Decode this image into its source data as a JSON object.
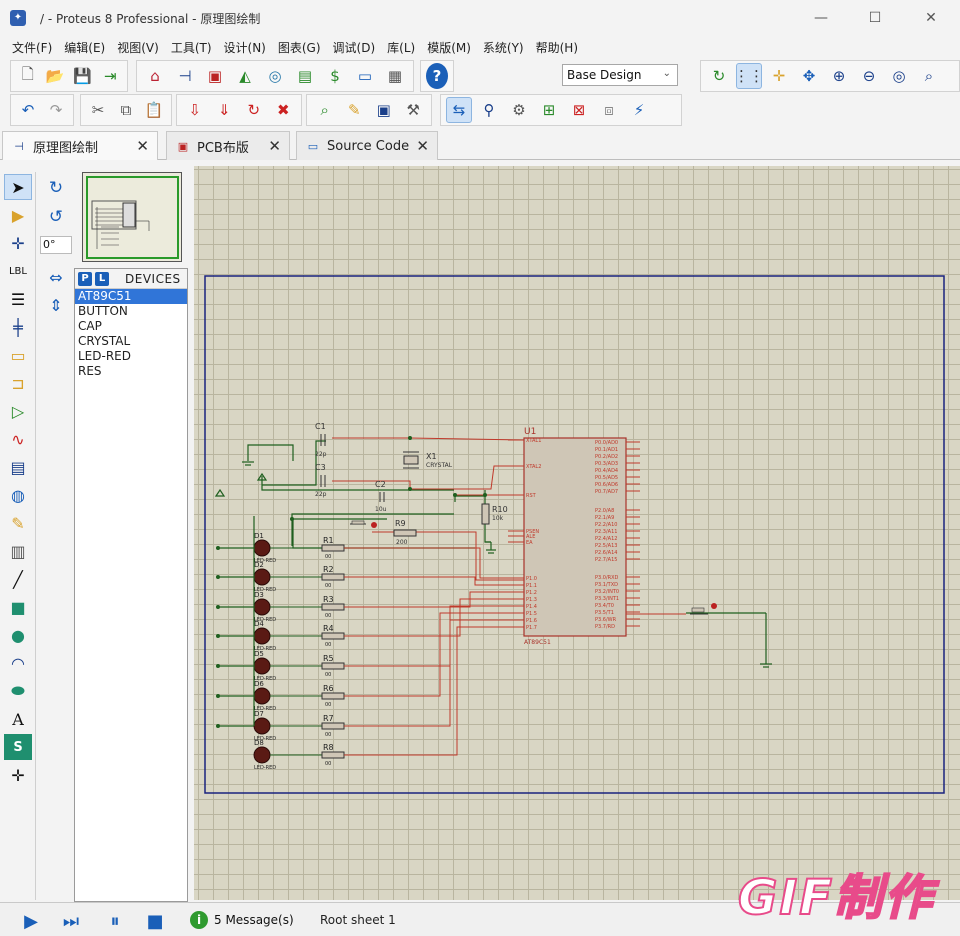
{
  "window": {
    "title": "/ - Proteus 8 Professional - 原理图绘制",
    "minimize": "—",
    "maximize": "☐",
    "close": "✕"
  },
  "menu": [
    "文件(F)",
    "编辑(E)",
    "视图(V)",
    "工具(T)",
    "设计(N)",
    "图表(G)",
    "调试(D)",
    "库(L)",
    "模版(M)",
    "系统(Y)",
    "帮助(H)"
  ],
  "toolbar": {
    "design_select": "Base Design"
  },
  "tabs": [
    {
      "label": "原理图绘制",
      "close": "✕"
    },
    {
      "label": "PCB布版",
      "close": "✕"
    },
    {
      "label": "Source Code",
      "close": "✕"
    }
  ],
  "rotation": {
    "angle": "0°"
  },
  "devices_panel": {
    "p_button": "P",
    "l_button": "L",
    "title": "DEVICES",
    "items": [
      "AT89C51",
      "BUTTON",
      "CAP",
      "CRYSTAL",
      "LED-RED",
      "RES"
    ],
    "selected": "AT89C51"
  },
  "schematic": {
    "u1_label": "U1",
    "mcu_footer": "AT89C51",
    "crystal_ref": "X1",
    "crystal_val": "CRYSTAL",
    "c1_ref": "C1",
    "c1_val": "22p",
    "c3_ref": "C3",
    "c3_val": "22p",
    "c2_ref": "C2",
    "c2_val": "10u",
    "r10_ref": "R10",
    "r10_val": "10k",
    "r9_ref": "R9",
    "r9_val": "200",
    "left_pins": [
      "XTAL1",
      "XTAL2",
      "RST",
      "PSEN",
      "ALE",
      "EA",
      "P1.0",
      "P1.1",
      "P1.2",
      "P1.3",
      "P1.4",
      "P1.5",
      "P1.6",
      "P1.7"
    ],
    "right_pins": [
      "P0.0/AD0",
      "P0.1/AD1",
      "P0.2/AD2",
      "P0.3/AD3",
      "P0.4/AD4",
      "P0.5/AD5",
      "P0.6/AD6",
      "P0.7/AD7",
      "P2.0/A8",
      "P2.1/A9",
      "P2.2/A10",
      "P2.3/A11",
      "P2.4/A12",
      "P2.5/A13",
      "P2.6/A14",
      "P2.7/A15",
      "P3.0/RXD",
      "P3.1/TXD",
      "P3.2/INT0",
      "P3.3/INT1",
      "P3.4/T0",
      "P3.5/T1",
      "P3.6/WR",
      "P3.7/RD"
    ],
    "leds": [
      {
        "ref": "D1",
        "val": "LED-RED"
      },
      {
        "ref": "D2",
        "val": "LED-RED"
      },
      {
        "ref": "D3",
        "val": "LED-RED"
      },
      {
        "ref": "D4",
        "val": "LED-RED"
      },
      {
        "ref": "D5",
        "val": "LED-RED"
      },
      {
        "ref": "D6",
        "val": "LED-RED"
      },
      {
        "ref": "D7",
        "val": "LED-RED"
      },
      {
        "ref": "D8",
        "val": "LED-RED"
      }
    ],
    "resistors": [
      {
        "ref": "R1",
        "val": "00"
      },
      {
        "ref": "R2",
        "val": "00"
      },
      {
        "ref": "R3",
        "val": "00"
      },
      {
        "ref": "R4",
        "val": "00"
      },
      {
        "ref": "R5",
        "val": "00"
      },
      {
        "ref": "R6",
        "val": "00"
      },
      {
        "ref": "R7",
        "val": "00"
      },
      {
        "ref": "R8",
        "val": "00"
      }
    ]
  },
  "status": {
    "messages": "5 Message(s)",
    "sheet": "Root sheet 1"
  },
  "watermark": "GIF制作",
  "colors": {
    "wire_red": "#c0392b",
    "wire_green": "#1f5f1f",
    "sheet_border": "#1a237e",
    "canvas_bg": "#d9d6c4",
    "selection": "#3075d8"
  }
}
